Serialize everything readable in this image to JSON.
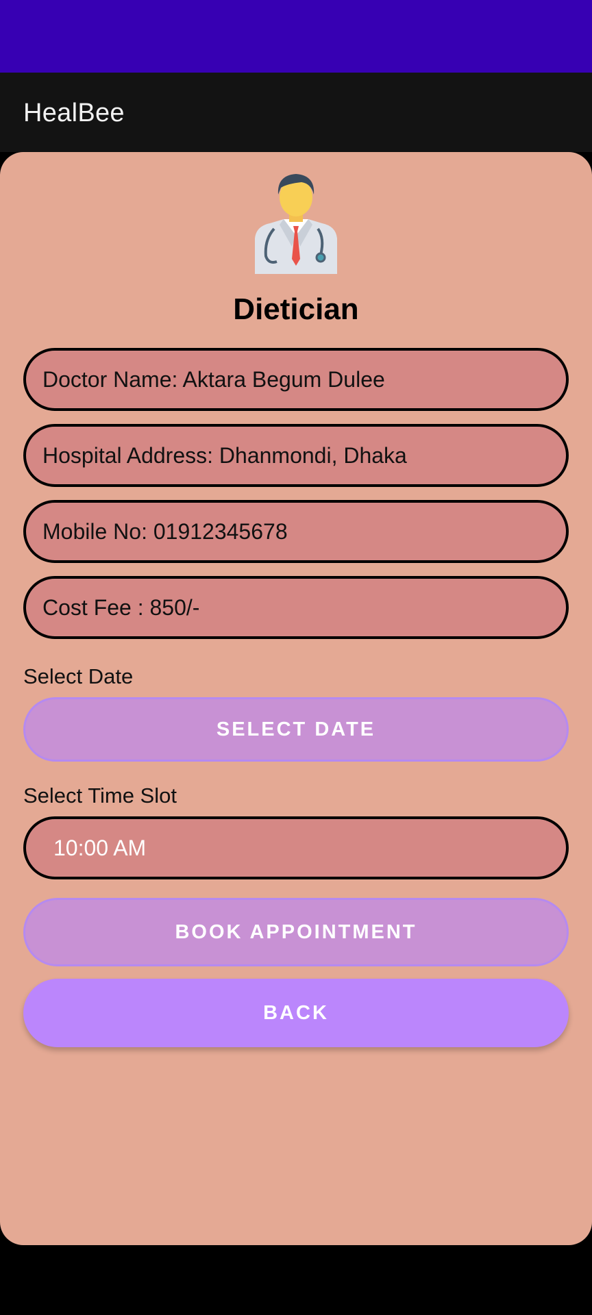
{
  "app": {
    "title": "HealBee"
  },
  "doctor": {
    "specialty": "Dietician",
    "name_line": "Doctor Name: Aktara Begum Dulee",
    "address_line": "Hospital Address: Dhanmondi, Dhaka",
    "mobile_line": "Mobile No: 01912345678",
    "fee_line": "Cost Fee : 850/-"
  },
  "date_section": {
    "label": "Select Date",
    "button_label": "SELECT DATE"
  },
  "time_section": {
    "label": "Select Time Slot",
    "selected_value": "10:00 AM"
  },
  "actions": {
    "book_label": "BOOK APPOINTMENT",
    "back_label": "BACK"
  },
  "colors": {
    "status_bar": "#3700b3",
    "app_bar": "#131313",
    "card_background": "#e4a994",
    "info_pill": "#d58885",
    "button_light": "#c891d4",
    "button_back": "#bb86fc"
  },
  "icons": {
    "avatar": "doctor-avatar-icon"
  }
}
